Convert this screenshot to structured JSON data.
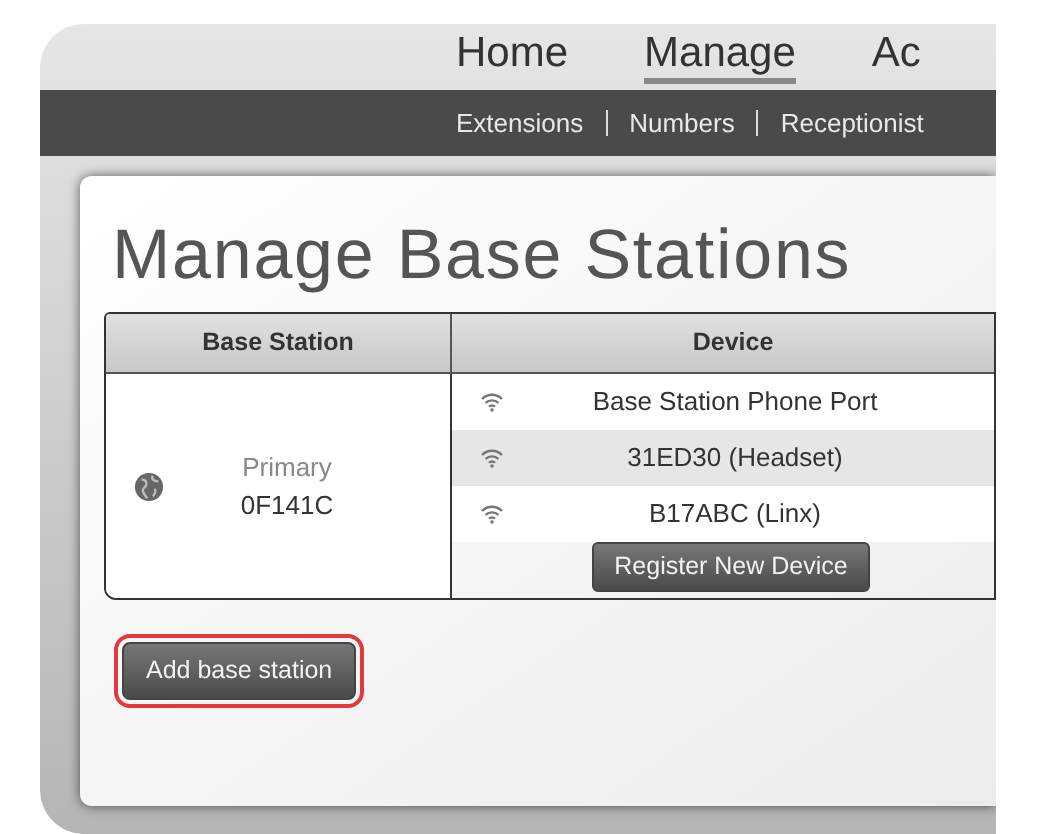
{
  "nav": [
    {
      "label": "Home",
      "selected": false
    },
    {
      "label": "Manage",
      "selected": true
    },
    {
      "label": "Ac",
      "selected": false
    }
  ],
  "subnav": [
    "Extensions",
    "Numbers",
    "Receptionist"
  ],
  "title": "Manage Base Stations",
  "table": {
    "columns": [
      "Base Station",
      "Device"
    ],
    "base_station": {
      "label": "Primary",
      "id": "0F141C"
    },
    "devices": [
      {
        "name": "Base Station Phone Port",
        "shaded": false
      },
      {
        "name": "31ED30 (Headset)",
        "shaded": true
      },
      {
        "name": "B17ABC (Linx)",
        "shaded": false
      }
    ],
    "register_button": "Register New Device"
  },
  "add_button": {
    "label": "Add base station",
    "highlighted": true
  }
}
